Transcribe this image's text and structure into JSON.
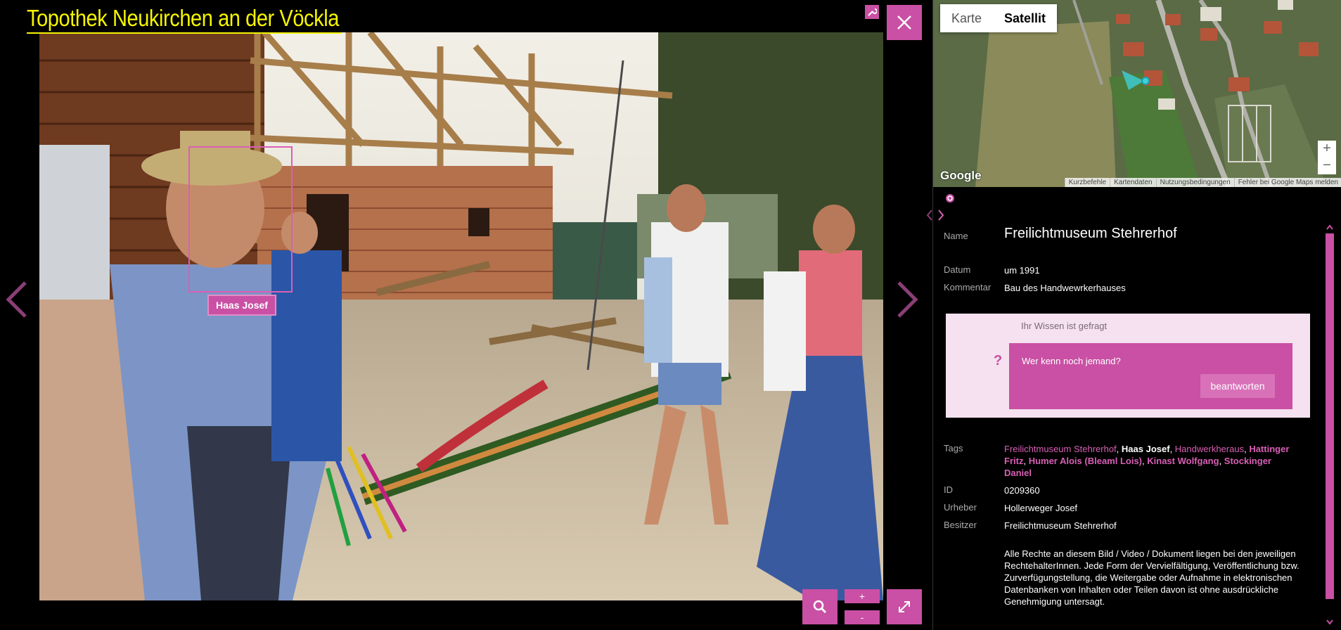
{
  "viewer": {
    "site_title": "Topothek Neukirchen an der Vöckla",
    "person_tag": "Haas Josef",
    "zoom_in_label": "+",
    "zoom_out_label": "-"
  },
  "map": {
    "toggle_map": "Karte",
    "toggle_satellite": "Satellit",
    "logo": "Google",
    "zoom_plus": "+",
    "zoom_minus": "−",
    "attributions": [
      "Kurzbefehle",
      "Kartendaten",
      "Nutzungsbedingungen",
      "Fehler bei Google Maps melden"
    ]
  },
  "details": {
    "name_label": "Name",
    "name_value": "Freilichtmuseum Stehrerhof",
    "date_label": "Datum",
    "date_value": "um 1991",
    "comment_label": "Kommentar",
    "comment_value": "Bau des Handwewrkerhauses",
    "question_title": "Ihr Wissen ist gefragt",
    "question_mark": "?",
    "question_text": "Wer kenn noch jemand?",
    "answer_button": "beantworten",
    "tags_label": "Tags",
    "tags": [
      {
        "text": "Freilichtmuseum Stehrerhof",
        "style": "link"
      },
      {
        "text": "Haas Josef",
        "style": "plain"
      },
      {
        "text": "Handwerkheraus",
        "style": "link"
      },
      {
        "text": "Hattinger Fritz",
        "style": "link-bold"
      },
      {
        "text": "Humer Alois (Bleaml Lois)",
        "style": "link-bold"
      },
      {
        "text": "Kinast Wolfgang",
        "style": "link-bold"
      },
      {
        "text": "Stockinger Daniel",
        "style": "link-bold"
      }
    ],
    "id_label": "ID",
    "id_value": "0209360",
    "author_label": "Urheber",
    "author_value": "Hollerweger Josef",
    "owner_label": "Besitzer",
    "owner_value": "Freilichtmuseum Stehrerhof",
    "rights_text": "Alle Rechte an diesem Bild / Video / Dokument liegen bei den jeweiligen RechtehalterInnen. Jede Form der Vervielfältigung, Veröffentlichung bzw. Zurverfügungstellung, die Weitergabe oder Aufnahme in elektronischen Datenbanken von Inhalten oder Teilen davon ist ohne ausdrückliche Genehmigung untersagt."
  },
  "colors": {
    "accent": "#c950a4",
    "title_yellow": "#f5f500",
    "question_bg": "#f5e1ef"
  },
  "icons": [
    "wrench-icon",
    "close-icon",
    "search-icon",
    "fullscreen-icon",
    "chevron-left-icon",
    "chevron-right-icon",
    "locate-icon"
  ]
}
